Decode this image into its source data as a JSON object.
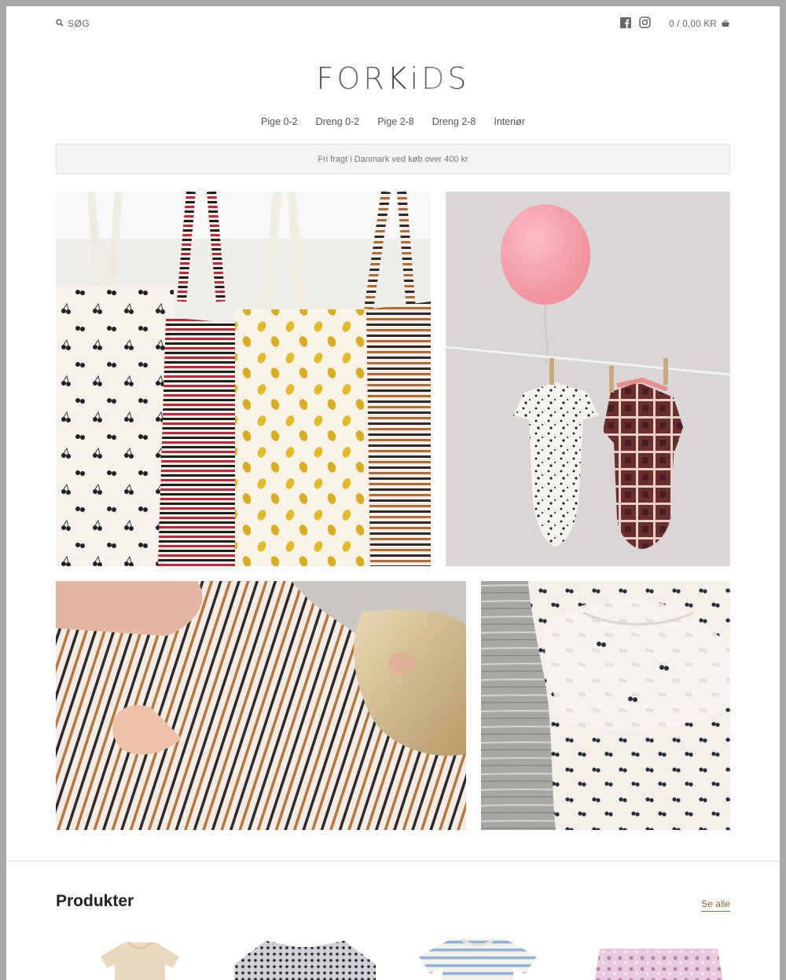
{
  "header": {
    "search_label": "SØG",
    "cart_label": "0 / 0,00 KR",
    "icons": [
      "search-icon",
      "facebook-icon",
      "instagram-icon",
      "basket-icon"
    ]
  },
  "logo": {
    "text": "FORKiDS"
  },
  "nav": {
    "items": [
      {
        "label": "Pige 0-2"
      },
      {
        "label": "Dreng 0-2"
      },
      {
        "label": "Pige 2-8"
      },
      {
        "label": "Dreng 2-8"
      },
      {
        "label": "Interiør"
      }
    ]
  },
  "announcement": {
    "text": "Fri fragt i Danmark ved køb over 400 kr"
  },
  "products_section": {
    "title": "Produkter",
    "see_all": "Se alle"
  },
  "colors": {
    "accent": "#8a6d2f",
    "announcement_bg": "#f3f3f3",
    "outer_frame": "#a9a9a9"
  }
}
